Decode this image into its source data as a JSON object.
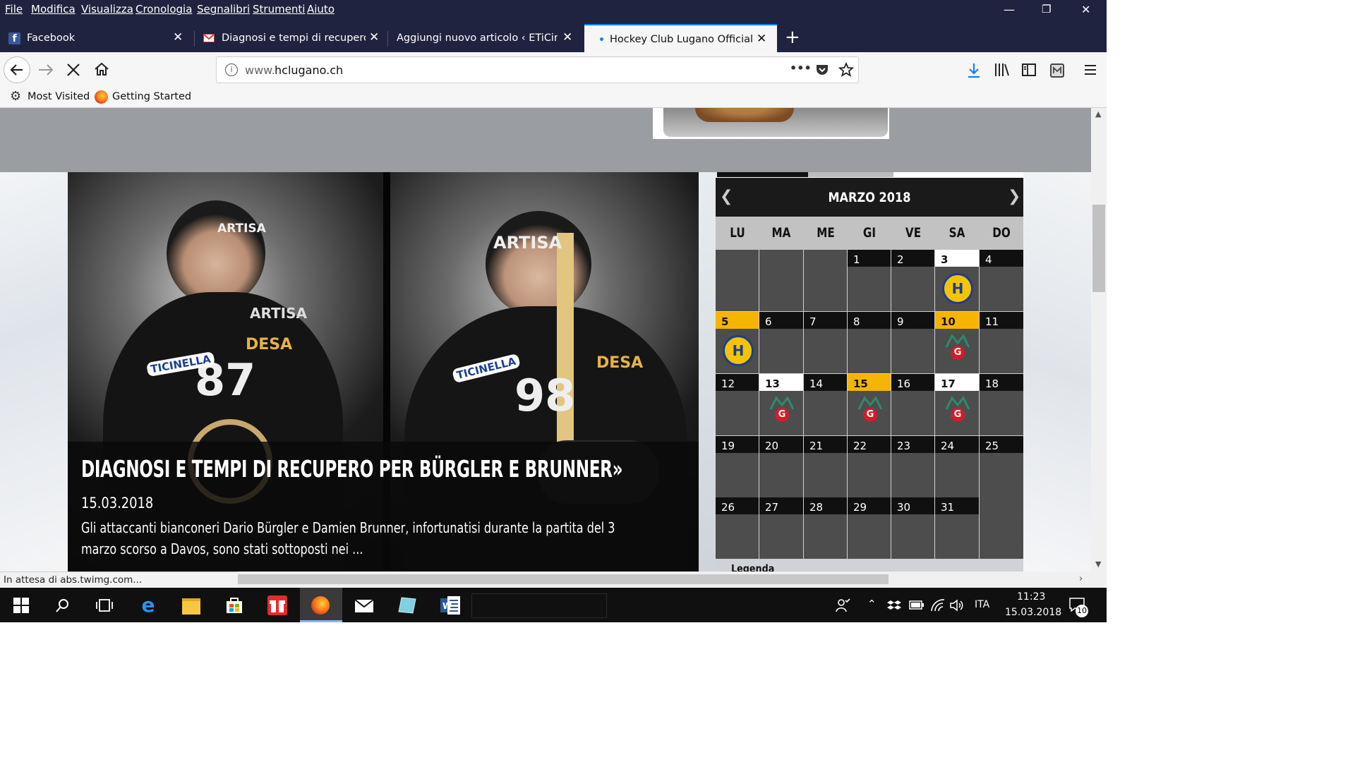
{
  "menu": {
    "items": [
      "File",
      "Modifica",
      "Visualizza",
      "Cronologia",
      "Segnalibri",
      "Strumenti",
      "Aiuto"
    ]
  },
  "window_controls": {
    "minimize": "—",
    "restore": "❐",
    "close": "✕"
  },
  "tabs": [
    {
      "title": "Facebook",
      "icon": "facebook-icon",
      "active": false
    },
    {
      "title": "Diagnosi e tempi di recupero p",
      "icon": "gmail-icon",
      "active": false
    },
    {
      "title": "Aggiungi nuovo articolo ‹ ETiCinfor",
      "icon": "none",
      "active": false
    },
    {
      "title": "Hockey Club Lugano Official W",
      "icon": "loading-dot",
      "active": true
    }
  ],
  "new_tab_label": "+",
  "address": {
    "prefix": "www.",
    "domain": "hclugano.ch",
    "more": "•••"
  },
  "bookmarks": [
    {
      "label": "Most Visited",
      "icon": "gear-icon"
    },
    {
      "label": "Getting Started",
      "icon": "firefox-icon"
    }
  ],
  "article": {
    "headline": "DIAGNOSI E TEMPI DI RECUPERO PER BÜRGLER E BRUNNER»",
    "date": "15.03.2018",
    "excerpt": "Gli attaccanti bianconeri Dario Bürgler e Damien Brunner, infortunatisi durante la partita del 3 marzo scorso a Davos, sono stati sottoposti nei ...",
    "photo_left_text": {
      "sponsor": "ARTISA",
      "number": "87",
      "sponsor2": "DESA",
      "sponsor3": "TICINELLA"
    },
    "photo_right_text": {
      "sponsor": "ARTISA",
      "number": "98",
      "sponsor2": "TICINELLA",
      "sponsor3": "DESA"
    }
  },
  "calendar": {
    "month": "MARZO 2018",
    "weekdays": [
      "LU",
      "MA",
      "ME",
      "GI",
      "VE",
      "SA",
      "DO"
    ],
    "weeks": [
      [
        null,
        null,
        null,
        {
          "d": "1"
        },
        {
          "d": "2"
        },
        {
          "d": "3",
          "hl": "white",
          "logo": "davos"
        },
        {
          "d": "4"
        }
      ],
      [
        {
          "d": "5",
          "hl": "yellow",
          "logo": "davos"
        },
        {
          "d": "6"
        },
        {
          "d": "7"
        },
        {
          "d": "8"
        },
        {
          "d": "9"
        },
        {
          "d": "10",
          "hl": "yellow",
          "logo": "geneve"
        },
        {
          "d": "11"
        }
      ],
      [
        {
          "d": "12"
        },
        {
          "d": "13",
          "hl": "white",
          "logo": "geneve"
        },
        {
          "d": "14"
        },
        {
          "d": "15",
          "hl": "yellow",
          "logo": "geneve"
        },
        {
          "d": "16"
        },
        {
          "d": "17",
          "hl": "white",
          "logo": "geneve"
        },
        {
          "d": "18"
        }
      ],
      [
        {
          "d": "19"
        },
        {
          "d": "20"
        },
        {
          "d": "21"
        },
        {
          "d": "22"
        },
        {
          "d": "23"
        },
        {
          "d": "24"
        },
        {
          "d": "25"
        }
      ],
      [
        {
          "d": "26"
        },
        {
          "d": "27"
        },
        {
          "d": "28"
        },
        {
          "d": "29"
        },
        {
          "d": "30"
        },
        {
          "d": "31"
        },
        null
      ]
    ],
    "legend_label": "Legenda",
    "logo_davos_text": "H",
    "logo_geneve_text": "G"
  },
  "status": {
    "text": "In attesa di abs.twimg.com..."
  },
  "taskbar": {
    "language": "ITA",
    "time": "11:23",
    "date": "15.03.2018",
    "notifications": "10"
  },
  "colors": {
    "titlebar": "#20233f",
    "active_tab_accent": "#0a84ff",
    "calendar_highlight": "#f5b400",
    "taskbar": "#101010"
  }
}
